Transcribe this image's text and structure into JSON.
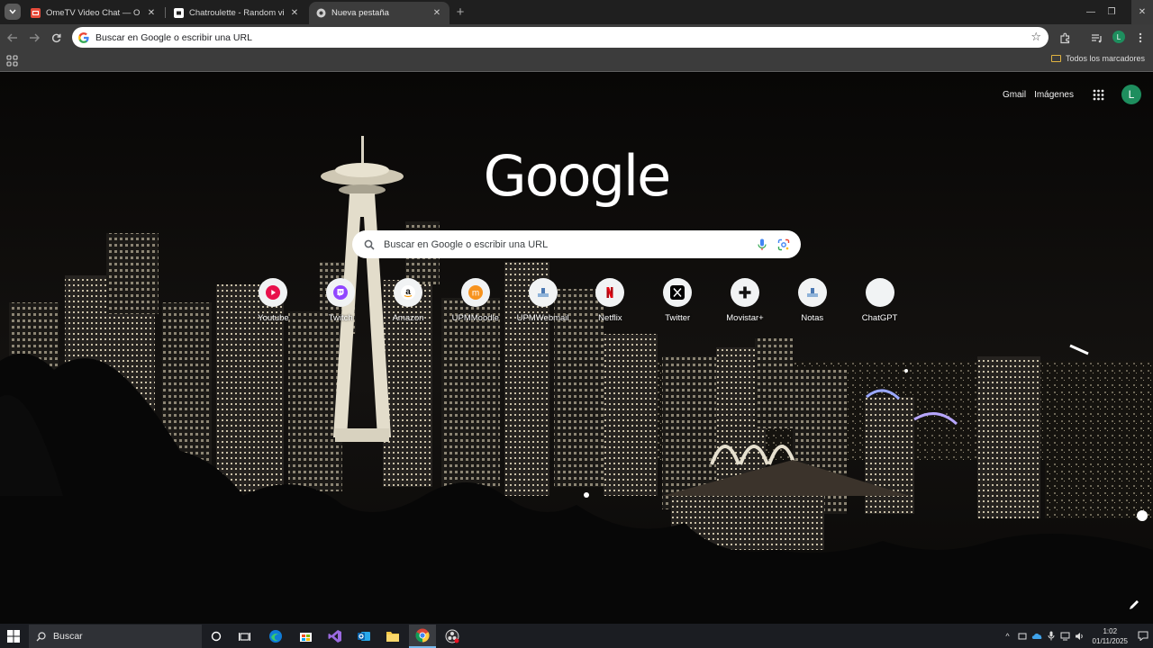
{
  "browser": {
    "tabs": [
      {
        "title": "OmeTV Video Chat — Omegle",
        "icon": "ometv-icon",
        "favicon_color": "#e74c3c"
      },
      {
        "title": "Chatroulette - Random video c",
        "icon": "chatroulette-icon",
        "favicon_color": "#ffffff"
      },
      {
        "title": "Nueva pestaña",
        "icon": "chrome-newtab-icon",
        "favicon_color": "#cfcfcf",
        "active": true
      }
    ],
    "new_tab_symbol": "+",
    "window_controls": {
      "minimize": "—",
      "restore": "❐",
      "close": "✕"
    },
    "address_bar": {
      "placeholder": "Buscar en Google o escribir una URL",
      "value": ""
    },
    "profile_initial": "L",
    "bookmarks": {
      "all_bookmarks_label": "Todos los marcadores"
    }
  },
  "ntp": {
    "top_links": {
      "gmail": "Gmail",
      "images": "Imágenes"
    },
    "profile_initial": "L",
    "logo_text": "Google",
    "search": {
      "placeholder": "Buscar en Google o escribir una URL"
    },
    "shortcuts": [
      {
        "label": "Youtube",
        "icon": "youtube-icon"
      },
      {
        "label": "Twitch",
        "icon": "twitch-icon"
      },
      {
        "label": "Amazon",
        "icon": "amazon-icon"
      },
      {
        "label": "UPMMoodle",
        "icon": "moodle-icon"
      },
      {
        "label": "UPMWebmail",
        "icon": "webmail-icon"
      },
      {
        "label": "Netflix",
        "icon": "netflix-icon"
      },
      {
        "label": "Twitter",
        "icon": "x-twitter-icon"
      },
      {
        "label": "Movistar+",
        "icon": "movistar-plus-icon"
      },
      {
        "label": "Notas",
        "icon": "notes-icon"
      },
      {
        "label": "ChatGPT",
        "icon": "chatgpt-icon"
      }
    ]
  },
  "taskbar": {
    "search_placeholder": "Buscar",
    "apps": [
      "cortana-icon",
      "task-view-icon",
      "edge-icon",
      "store-icon",
      "visual-studio-icon",
      "outlook-icon",
      "file-explorer-icon",
      "chrome-icon",
      "obs-icon"
    ],
    "clock": {
      "time": "1:02",
      "date": "01/11/2025"
    }
  },
  "colors": {
    "profile": "#1e8e5e",
    "accent": "#76b9ed",
    "chrome_dark": "#3c3c3c"
  }
}
